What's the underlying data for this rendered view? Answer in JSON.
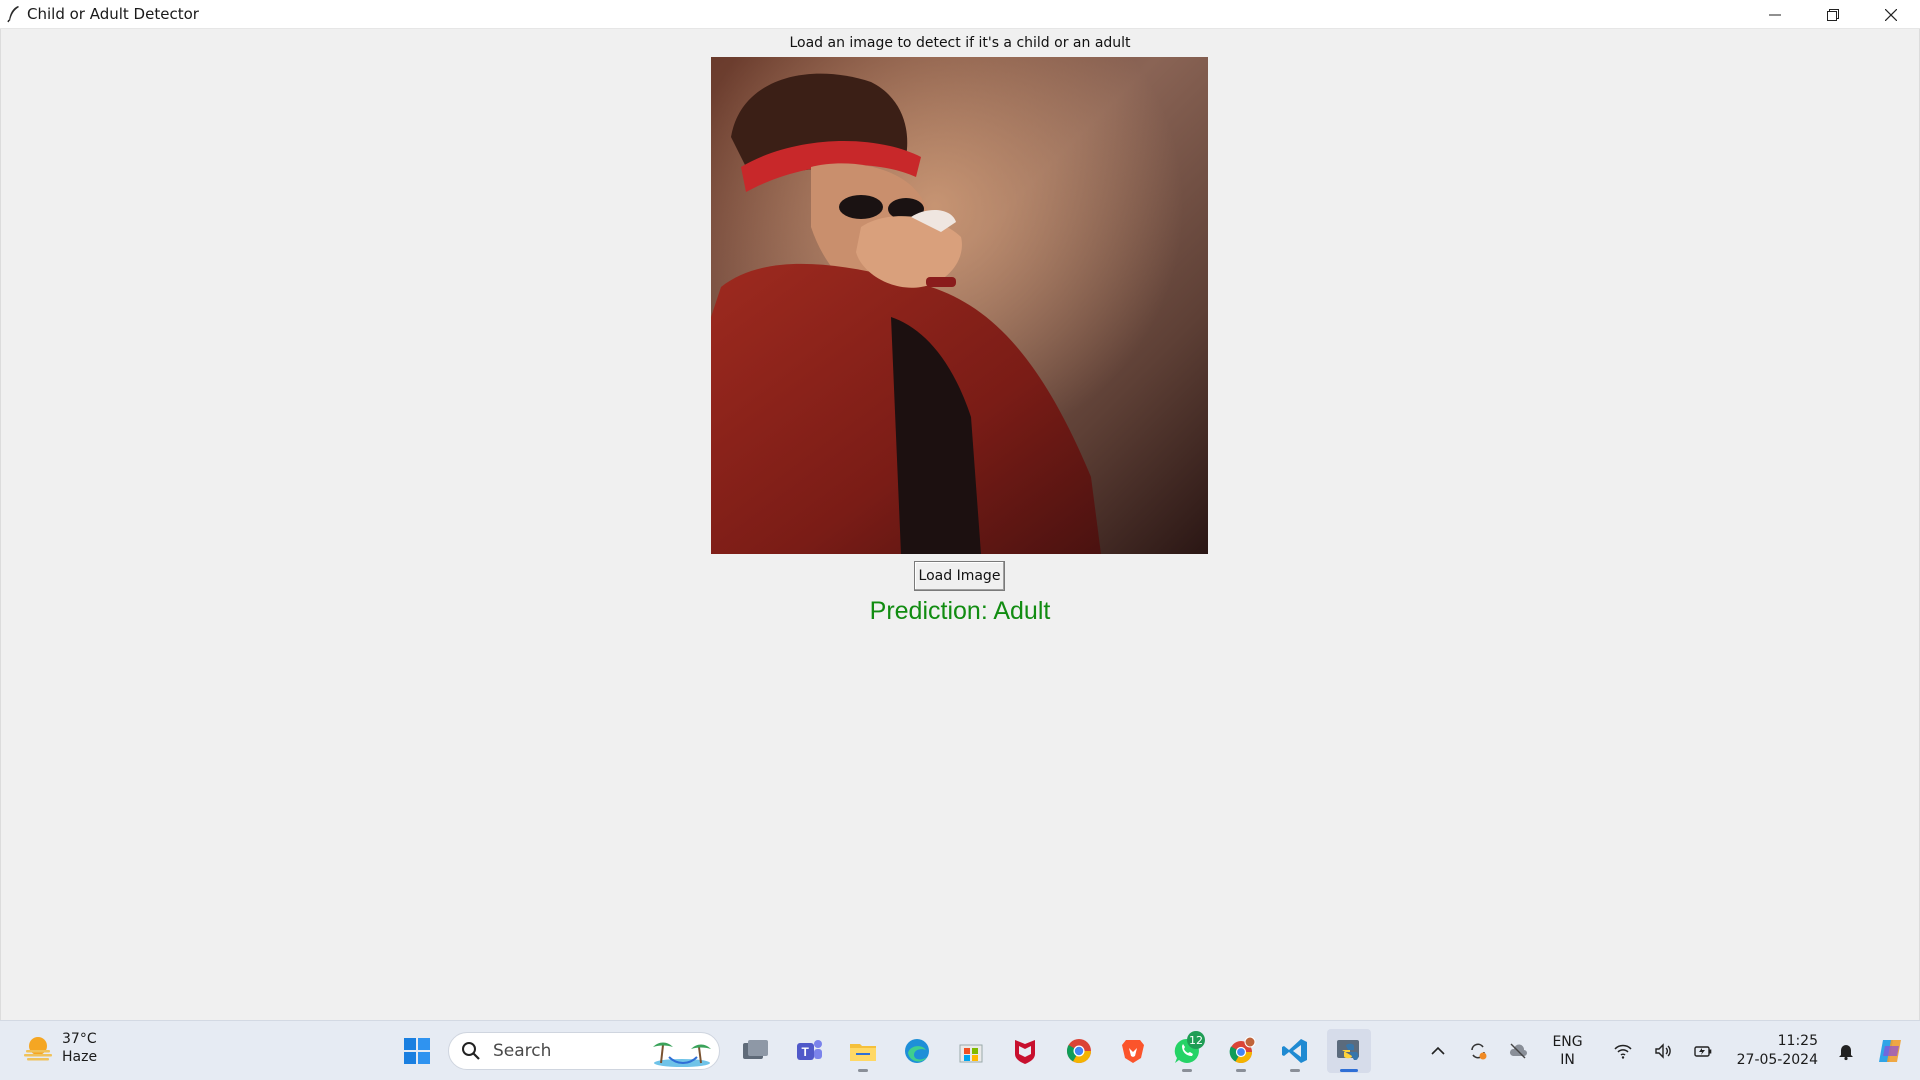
{
  "window": {
    "title": "Child or Adult Detector"
  },
  "app": {
    "instruction": "Load an image to detect if it's a child or an adult",
    "load_button": "Load Image",
    "prediction": "Prediction: Adult",
    "prediction_color": "#118c11"
  },
  "taskbar": {
    "weather": {
      "temp": "37°C",
      "condition": "Haze"
    },
    "search_placeholder": "Search",
    "whatsapp_badge": "12",
    "language": {
      "line1": "ENG",
      "line2": "IN"
    },
    "time": "11:25",
    "date": "27-05-2024",
    "accent": "#2f6fd6"
  }
}
